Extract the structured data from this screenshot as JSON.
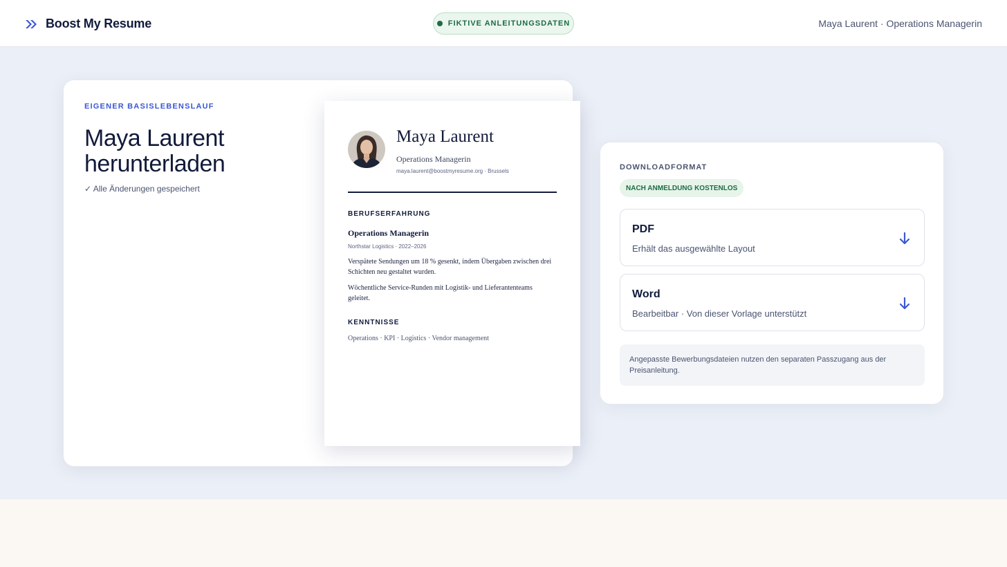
{
  "header": {
    "brand_name": "Boost My Resume",
    "demo_badge": "FIKTIVE ANLEITUNGSDATEN",
    "user_info": "Maya Laurent · Operations Managerin"
  },
  "resume_card": {
    "eyebrow": "EIGENER BASISLEBENSLAUF",
    "title": "Maya Laurent herunterladen",
    "save_status": "✓ Alle Änderungen gespeichert"
  },
  "preview": {
    "name": "Maya Laurent",
    "role": "Operations Managerin",
    "contact": "maya.laurent@boostmyresume.org · Brussels",
    "experience_heading": "BERUFSERFAHRUNG",
    "job_title": "Operations Managerin",
    "company": "Northstar Logistics · 2022–2026",
    "bullets": [
      "Verspätete Sendungen um 18 % gesenkt, indem Übergaben zwischen drei Schichten neu gestaltet wurden.",
      "Wöchentliche Service-Runden mit Logistik- und Lieferantenteams geleitet."
    ],
    "skills_heading": "KENNTNISSE",
    "skills": "Operations · KPI · Logistics · Vendor management"
  },
  "download": {
    "eyebrow": "DOWNLOADFORMAT",
    "badge": "NACH ANMELDUNG KOSTENLOS",
    "options": [
      {
        "title": "PDF",
        "description": "Erhält das ausgewählte Layout",
        "icon": "download-arrow-icon"
      },
      {
        "title": "Word",
        "description": "Bearbeitbar · Von dieser Vorlage unterstützt",
        "icon": "download-arrow-icon"
      }
    ],
    "note": "Angepasste Bewerbungsdateien nutzen den separaten Passzugang aus der Preisanleitung."
  },
  "colors": {
    "accent": "#3a57d6",
    "navy": "#111a3a",
    "success": "#1f6b45",
    "success_bg": "#e6f4ea",
    "main_bg": "#ebeff7"
  }
}
